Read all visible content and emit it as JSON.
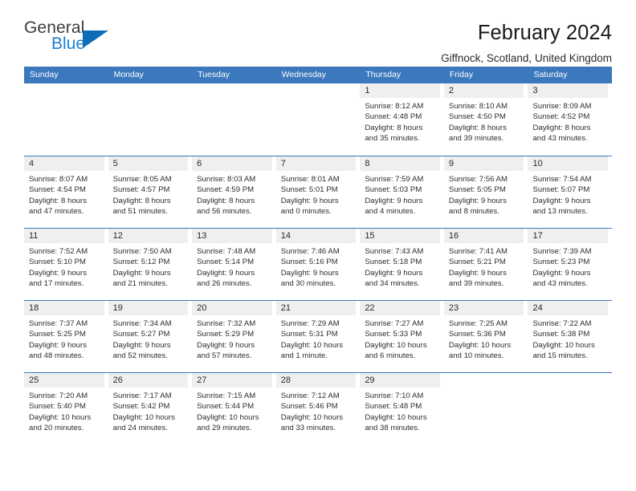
{
  "logo": {
    "word_top": "General",
    "word_bottom": "Blue",
    "triangle_color": "#0f6cb8",
    "blue_text_color": "#1a7fd4"
  },
  "header": {
    "title": "February 2024",
    "subtitle": "Giffnock, Scotland, United Kingdom"
  },
  "calendar": {
    "header_bg": "#3b78bd",
    "daynum_bg": "#efefef",
    "weekdays": [
      "Sunday",
      "Monday",
      "Tuesday",
      "Wednesday",
      "Thursday",
      "Friday",
      "Saturday"
    ],
    "weeks": [
      [
        {
          "day": "",
          "lines": []
        },
        {
          "day": "",
          "lines": []
        },
        {
          "day": "",
          "lines": []
        },
        {
          "day": "",
          "lines": []
        },
        {
          "day": "1",
          "lines": [
            "Sunrise: 8:12 AM",
            "Sunset: 4:48 PM",
            "Daylight: 8 hours",
            "and 35 minutes."
          ]
        },
        {
          "day": "2",
          "lines": [
            "Sunrise: 8:10 AM",
            "Sunset: 4:50 PM",
            "Daylight: 8 hours",
            "and 39 minutes."
          ]
        },
        {
          "day": "3",
          "lines": [
            "Sunrise: 8:09 AM",
            "Sunset: 4:52 PM",
            "Daylight: 8 hours",
            "and 43 minutes."
          ]
        }
      ],
      [
        {
          "day": "4",
          "lines": [
            "Sunrise: 8:07 AM",
            "Sunset: 4:54 PM",
            "Daylight: 8 hours",
            "and 47 minutes."
          ]
        },
        {
          "day": "5",
          "lines": [
            "Sunrise: 8:05 AM",
            "Sunset: 4:57 PM",
            "Daylight: 8 hours",
            "and 51 minutes."
          ]
        },
        {
          "day": "6",
          "lines": [
            "Sunrise: 8:03 AM",
            "Sunset: 4:59 PM",
            "Daylight: 8 hours",
            "and 56 minutes."
          ]
        },
        {
          "day": "7",
          "lines": [
            "Sunrise: 8:01 AM",
            "Sunset: 5:01 PM",
            "Daylight: 9 hours",
            "and 0 minutes."
          ]
        },
        {
          "day": "8",
          "lines": [
            "Sunrise: 7:59 AM",
            "Sunset: 5:03 PM",
            "Daylight: 9 hours",
            "and 4 minutes."
          ]
        },
        {
          "day": "9",
          "lines": [
            "Sunrise: 7:56 AM",
            "Sunset: 5:05 PM",
            "Daylight: 9 hours",
            "and 8 minutes."
          ]
        },
        {
          "day": "10",
          "lines": [
            "Sunrise: 7:54 AM",
            "Sunset: 5:07 PM",
            "Daylight: 9 hours",
            "and 13 minutes."
          ]
        }
      ],
      [
        {
          "day": "11",
          "lines": [
            "Sunrise: 7:52 AM",
            "Sunset: 5:10 PM",
            "Daylight: 9 hours",
            "and 17 minutes."
          ]
        },
        {
          "day": "12",
          "lines": [
            "Sunrise: 7:50 AM",
            "Sunset: 5:12 PM",
            "Daylight: 9 hours",
            "and 21 minutes."
          ]
        },
        {
          "day": "13",
          "lines": [
            "Sunrise: 7:48 AM",
            "Sunset: 5:14 PM",
            "Daylight: 9 hours",
            "and 26 minutes."
          ]
        },
        {
          "day": "14",
          "lines": [
            "Sunrise: 7:46 AM",
            "Sunset: 5:16 PM",
            "Daylight: 9 hours",
            "and 30 minutes."
          ]
        },
        {
          "day": "15",
          "lines": [
            "Sunrise: 7:43 AM",
            "Sunset: 5:18 PM",
            "Daylight: 9 hours",
            "and 34 minutes."
          ]
        },
        {
          "day": "16",
          "lines": [
            "Sunrise: 7:41 AM",
            "Sunset: 5:21 PM",
            "Daylight: 9 hours",
            "and 39 minutes."
          ]
        },
        {
          "day": "17",
          "lines": [
            "Sunrise: 7:39 AM",
            "Sunset: 5:23 PM",
            "Daylight: 9 hours",
            "and 43 minutes."
          ]
        }
      ],
      [
        {
          "day": "18",
          "lines": [
            "Sunrise: 7:37 AM",
            "Sunset: 5:25 PM",
            "Daylight: 9 hours",
            "and 48 minutes."
          ]
        },
        {
          "day": "19",
          "lines": [
            "Sunrise: 7:34 AM",
            "Sunset: 5:27 PM",
            "Daylight: 9 hours",
            "and 52 minutes."
          ]
        },
        {
          "day": "20",
          "lines": [
            "Sunrise: 7:32 AM",
            "Sunset: 5:29 PM",
            "Daylight: 9 hours",
            "and 57 minutes."
          ]
        },
        {
          "day": "21",
          "lines": [
            "Sunrise: 7:29 AM",
            "Sunset: 5:31 PM",
            "Daylight: 10 hours",
            "and 1 minute."
          ]
        },
        {
          "day": "22",
          "lines": [
            "Sunrise: 7:27 AM",
            "Sunset: 5:33 PM",
            "Daylight: 10 hours",
            "and 6 minutes."
          ]
        },
        {
          "day": "23",
          "lines": [
            "Sunrise: 7:25 AM",
            "Sunset: 5:36 PM",
            "Daylight: 10 hours",
            "and 10 minutes."
          ]
        },
        {
          "day": "24",
          "lines": [
            "Sunrise: 7:22 AM",
            "Sunset: 5:38 PM",
            "Daylight: 10 hours",
            "and 15 minutes."
          ]
        }
      ],
      [
        {
          "day": "25",
          "lines": [
            "Sunrise: 7:20 AM",
            "Sunset: 5:40 PM",
            "Daylight: 10 hours",
            "and 20 minutes."
          ]
        },
        {
          "day": "26",
          "lines": [
            "Sunrise: 7:17 AM",
            "Sunset: 5:42 PM",
            "Daylight: 10 hours",
            "and 24 minutes."
          ]
        },
        {
          "day": "27",
          "lines": [
            "Sunrise: 7:15 AM",
            "Sunset: 5:44 PM",
            "Daylight: 10 hours",
            "and 29 minutes."
          ]
        },
        {
          "day": "28",
          "lines": [
            "Sunrise: 7:12 AM",
            "Sunset: 5:46 PM",
            "Daylight: 10 hours",
            "and 33 minutes."
          ]
        },
        {
          "day": "29",
          "lines": [
            "Sunrise: 7:10 AM",
            "Sunset: 5:48 PM",
            "Daylight: 10 hours",
            "and 38 minutes."
          ]
        },
        {
          "day": "",
          "lines": []
        },
        {
          "day": "",
          "lines": []
        }
      ]
    ]
  }
}
